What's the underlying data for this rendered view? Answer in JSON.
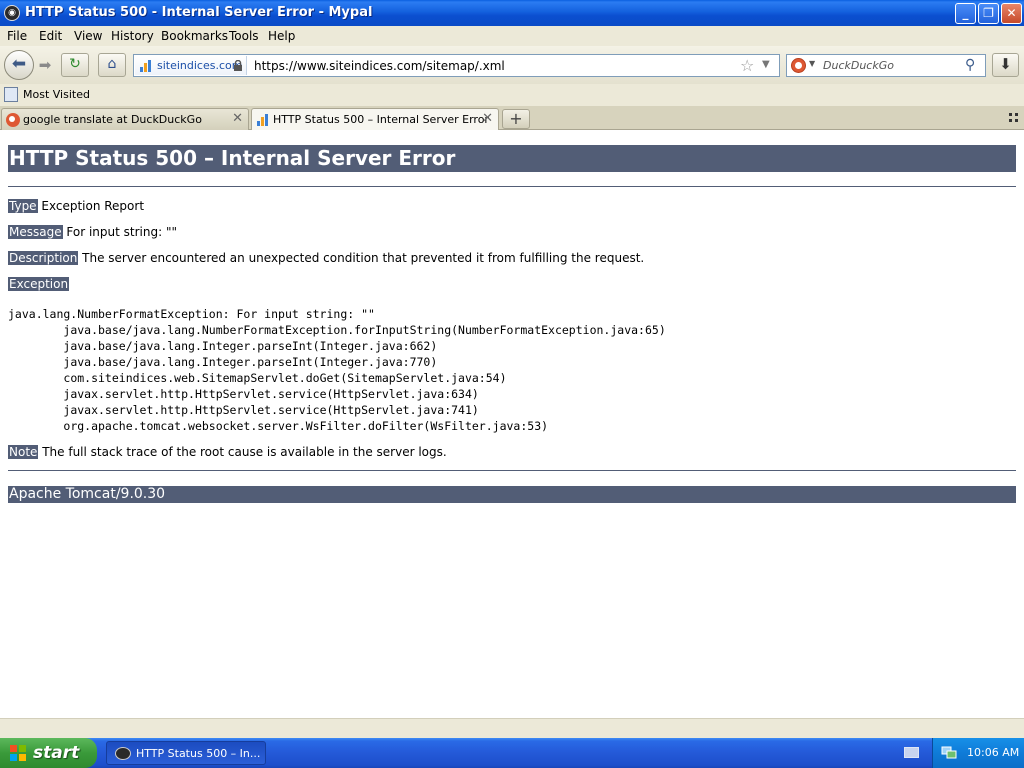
{
  "window": {
    "title": "HTTP Status 500 - Internal Server Error - Mypal",
    "minimize": "_",
    "maximize": "❐",
    "close": "✕"
  },
  "menu": {
    "items": [
      "File",
      "Edit",
      "View",
      "History",
      "Bookmarks",
      "Tools",
      "Help"
    ]
  },
  "navbar": {
    "site_host": "siteindices.com",
    "url": "https://www.siteindices.com/sitemap/.xml",
    "search_placeholder": "DuckDuckGo"
  },
  "bookmarks": {
    "most_visited": "Most Visited"
  },
  "tabs": [
    {
      "label": "google translate at DuckDuckGo",
      "active": false
    },
    {
      "label": "HTTP Status 500 – Internal Server Error",
      "active": true
    }
  ],
  "page": {
    "heading": "HTTP Status 500 – Internal Server Error",
    "type_label": "Type",
    "type_value": " Exception Report",
    "message_label": "Message",
    "message_value": " For input string: \"\"",
    "description_label": "Description",
    "description_value": " The server encountered an unexpected condition that prevented it from fulfilling the request.",
    "exception_label": "Exception",
    "stack_trace": "java.lang.NumberFormatException: For input string: \"\"\n\tjava.base/java.lang.NumberFormatException.forInputString(NumberFormatException.java:65)\n\tjava.base/java.lang.Integer.parseInt(Integer.java:662)\n\tjava.base/java.lang.Integer.parseInt(Integer.java:770)\n\tcom.siteindices.web.SitemapServlet.doGet(SitemapServlet.java:54)\n\tjavax.servlet.http.HttpServlet.service(HttpServlet.java:634)\n\tjavax.servlet.http.HttpServlet.service(HttpServlet.java:741)\n\torg.apache.tomcat.websocket.server.WsFilter.doFilter(WsFilter.java:53)",
    "note_label": "Note",
    "note_value": " The full stack trace of the root cause is available in the server logs.",
    "server_footer": "Apache Tomcat/9.0.30"
  },
  "taskbar": {
    "start_label": "start",
    "task_label": "HTTP Status 500 – In...",
    "clock": "10:06 AM"
  },
  "colors": {
    "tomcat_bar": "#525d76",
    "xp_blue": "#2459d8",
    "start_green": "#3a9a3a"
  }
}
